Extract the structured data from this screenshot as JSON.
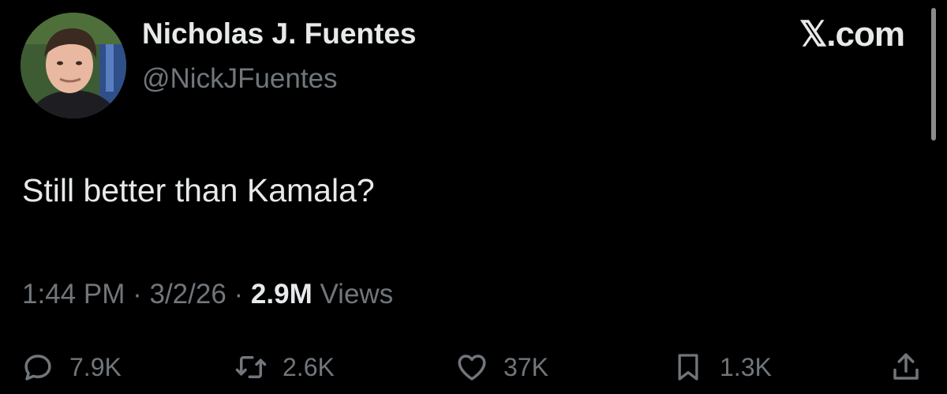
{
  "author": {
    "display_name": "Nicholas J. Fuentes",
    "handle": "@NickJFuentes"
  },
  "site": {
    "mark": "𝕏.com"
  },
  "tweet": {
    "text": "Still better than Kamala?",
    "time": "1:44 PM",
    "separator": "·",
    "date": "3/2/26",
    "views_count": "2.9M",
    "views_label": "Views"
  },
  "actions": {
    "replies": "7.9K",
    "reposts": "2.6K",
    "likes": "37K",
    "bookmarks": "1.3K"
  },
  "icons": {
    "reply": "reply-icon",
    "repost": "repost-icon",
    "like": "heart-icon",
    "bookmark": "bookmark-icon",
    "share": "share-icon"
  },
  "colors": {
    "background": "#000000",
    "primary_text": "#e7e9ea",
    "secondary_text": "#71767b"
  }
}
